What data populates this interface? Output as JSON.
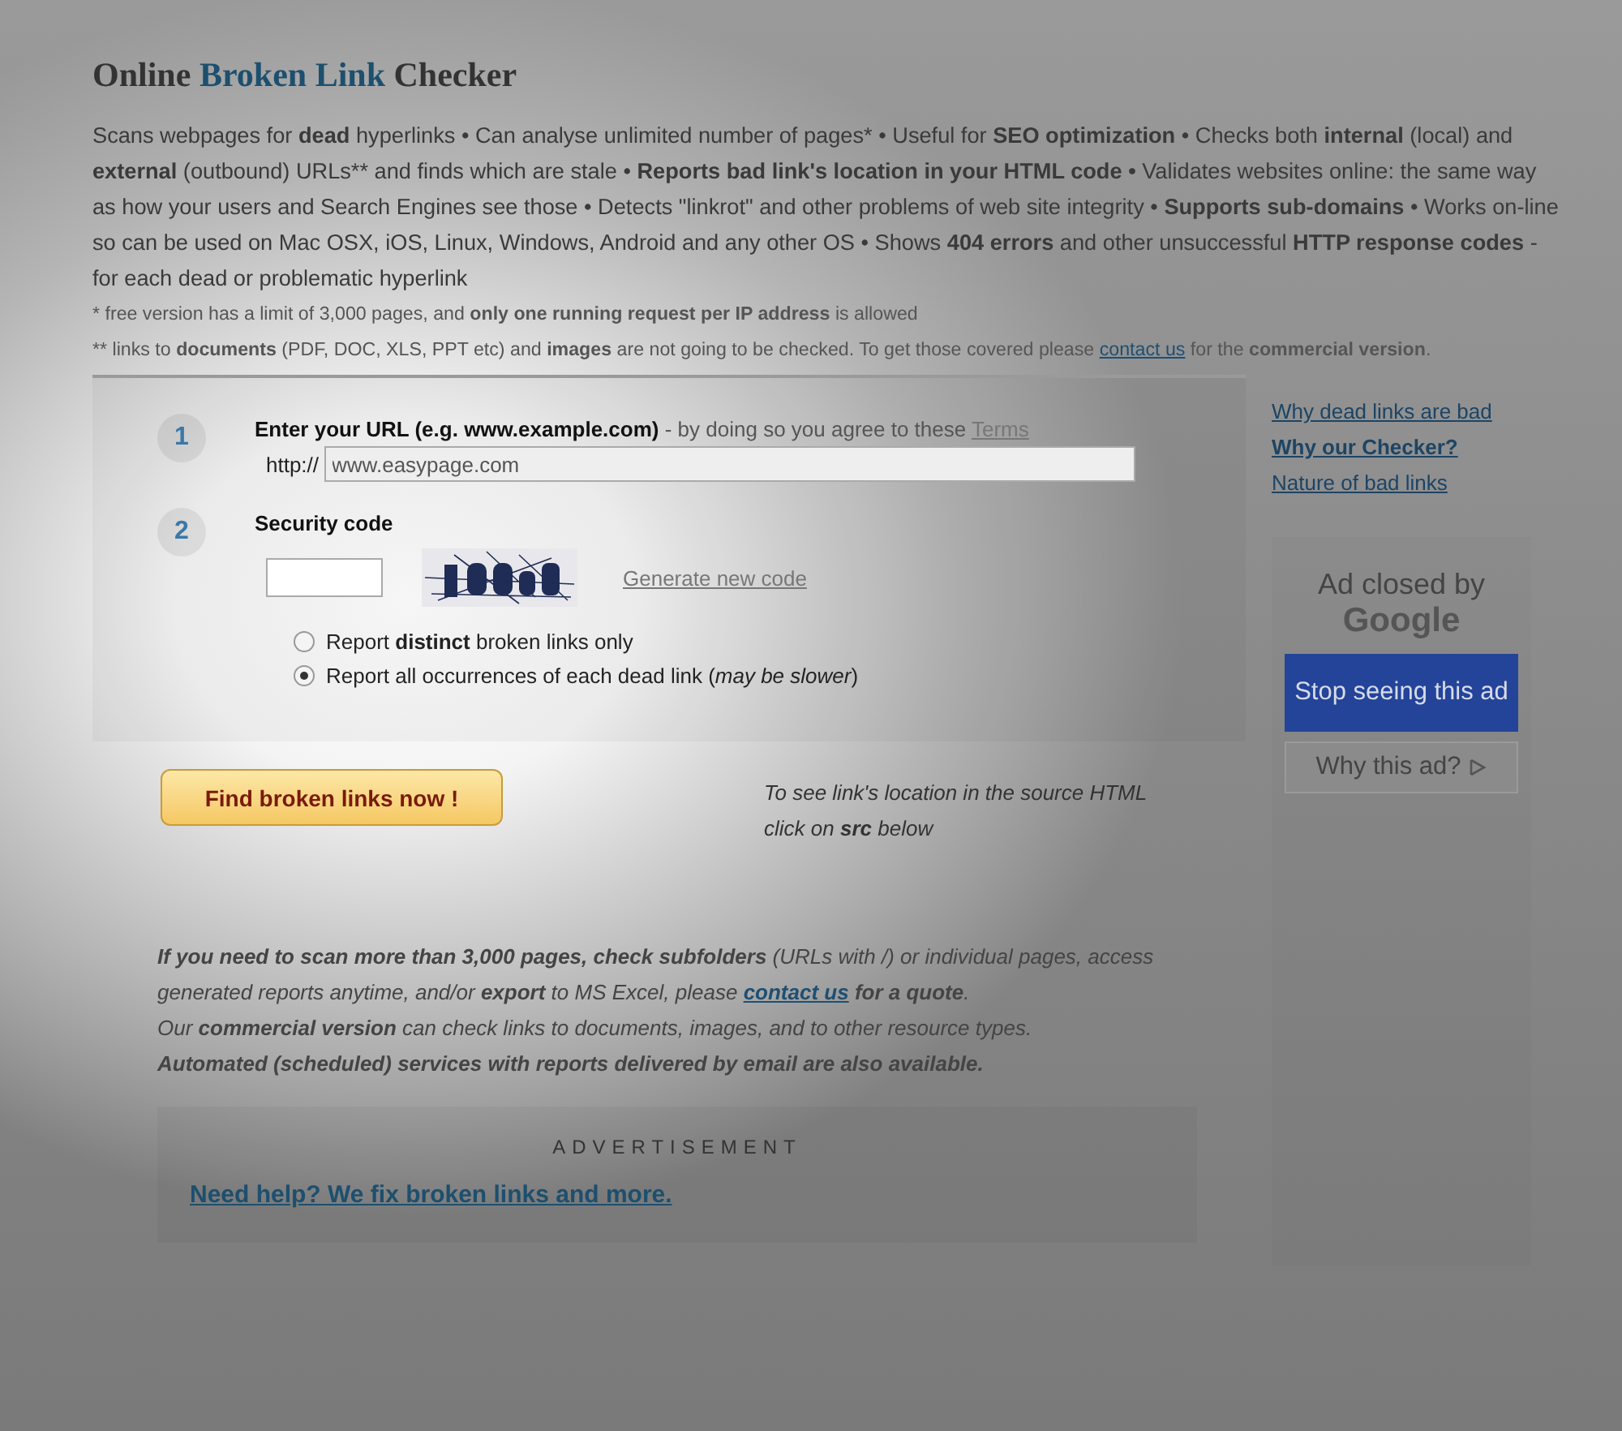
{
  "title": {
    "parts": [
      {
        "text": "Online",
        "kind": "plain"
      },
      {
        "text": "Broken Link",
        "kind": "accent"
      },
      {
        "text": "Checker",
        "kind": "plain"
      }
    ]
  },
  "description": "Scans webpages for **dead** hyperlinks • Can analyse unlimited number of pages* • Useful for **SEO optimization** • Checks both **internal** (local) and **external** (outbound) URLs** and finds which are stale • **Reports bad link's location in your HTML code •** Validates websites online: the same way as how your users and Search Engines see those • Detects \"linkrot\" and other problems of web site integrity • **Supports sub-domains** • Works on-line so can be used on Mac OSX, iOS, Linux, Windows, Android and any other OS • Shows **404 errors** and other unsuccessful **HTTP response codes** - for each dead or problematic hyperlink",
  "notes": [
    {
      "segments": [
        {
          "kind": "text",
          "text": "*  free version has a limit of 3,000 pages, and **only one running request per IP address** is allowed"
        }
      ]
    },
    {
      "segments": [
        {
          "kind": "text",
          "text": "** links to **documents** (PDF, DOC, XLS, PPT etc) and **images** are not going to be checked. To get those covered please "
        },
        {
          "kind": "link",
          "text": "contact us"
        },
        {
          "kind": "text",
          "text": " for the **commercial version**."
        }
      ]
    }
  ],
  "form": {
    "step1": {
      "number": "1",
      "label": "Enter your URL (e.g. **www.example.com**)",
      "hint": " - by doing so you agree to these ",
      "terms_link": "Terms",
      "prefix": "http://",
      "value": "www.easypage.com"
    },
    "step2": {
      "number": "2",
      "label": "Security code",
      "generate_link": "Generate new code"
    },
    "options": [
      {
        "text": "Report **distinct** broken links only",
        "selected": false
      },
      {
        "text": "Report all occurrences of each dead link (*may be slower*)",
        "selected": true
      }
    ],
    "submit": "Find broken links now !",
    "src_hint": "To see link's location in the source HTML click on **src** below"
  },
  "info": [
    {
      "kind": "plain",
      "segments": [
        {
          "kind": "text",
          "text": "**If you need to scan more than 3,000 pages, check subfolders** (URLs with /) or individual pages, access generated reports anytime, and/or **export** to MS Excel, please "
        },
        {
          "kind": "link",
          "text": "contact us"
        },
        {
          "kind": "text",
          "text": " **for a quote**."
        }
      ]
    },
    {
      "kind": "plain",
      "segments": [
        {
          "kind": "text",
          "text": "Our **commercial version** can check links to documents, images, and to other resource types."
        }
      ]
    },
    {
      "kind": "bold",
      "segments": [
        {
          "kind": "text",
          "text": "Automated (scheduled) services with reports delivered by email are also available."
        }
      ]
    }
  ],
  "advertisement": {
    "label": "ADVERTISEMENT",
    "link": "Need help? We fix broken links and more."
  },
  "sidebar": {
    "links": [
      {
        "text": "Why dead links are bad",
        "selected": false
      },
      {
        "text": "Why our Checker?",
        "selected": true
      },
      {
        "text": "Nature of bad links",
        "selected": false
      }
    ],
    "ad": {
      "closed_text": "Ad closed by",
      "brand": "Google",
      "stop_button": "Stop seeing this ad",
      "why_button": "Why this ad?"
    }
  }
}
